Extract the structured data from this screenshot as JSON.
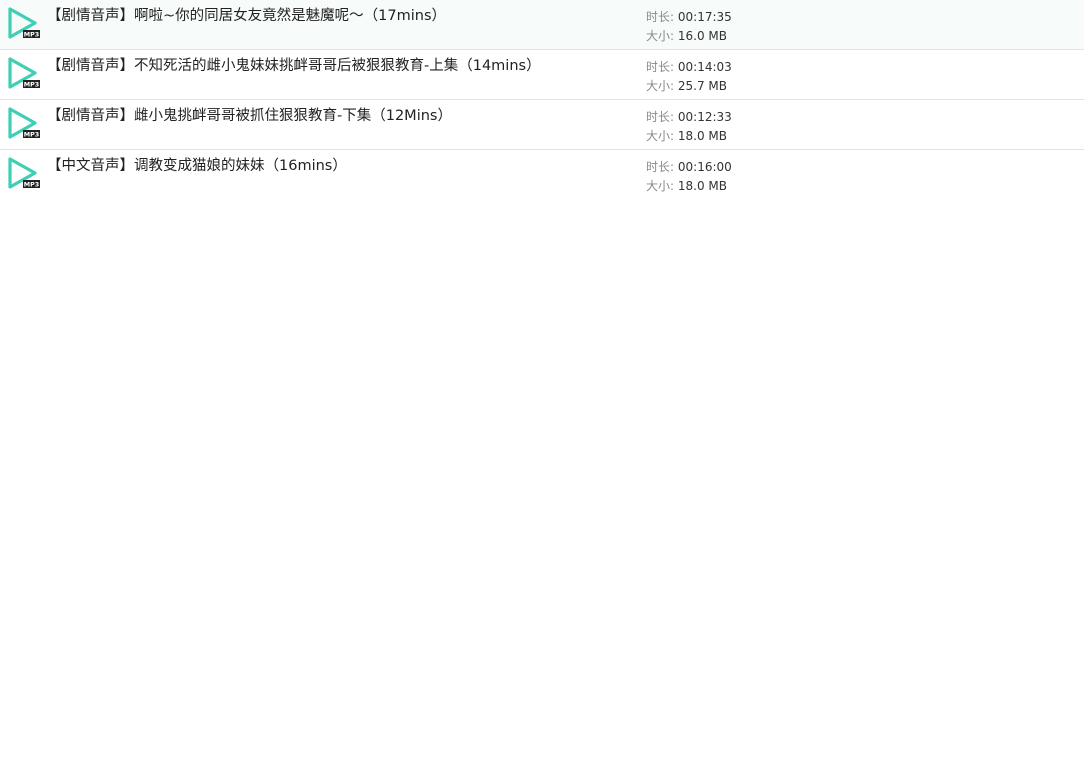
{
  "colors": {
    "icon_accent": "#3ecfb4",
    "icon_badge": "#222222",
    "divider": "#e3e3e3"
  },
  "icon": {
    "name": "mp3-play-icon",
    "badge_text": "MP3"
  },
  "labels": {
    "duration": "时长:",
    "size": "大小:"
  },
  "files": [
    {
      "title": "【剧情音声】啊啦~你的同居女友竟然是魅魔呢～（17mins）",
      "duration": "00:17:35",
      "size": "16.0 MB"
    },
    {
      "title": "【剧情音声】不知死活的雌小鬼妹妹挑衅哥哥后被狠狠教育-上集（14mins）",
      "duration": "00:14:03",
      "size": "25.7 MB"
    },
    {
      "title": "【剧情音声】雌小鬼挑衅哥哥被抓住狠狠教育-下集（12Mins）",
      "duration": "00:12:33",
      "size": "18.0 MB"
    },
    {
      "title": "【中文音声】调教变成猫娘的妹妹（16mins）",
      "duration": "00:16:00",
      "size": "18.0 MB"
    }
  ]
}
